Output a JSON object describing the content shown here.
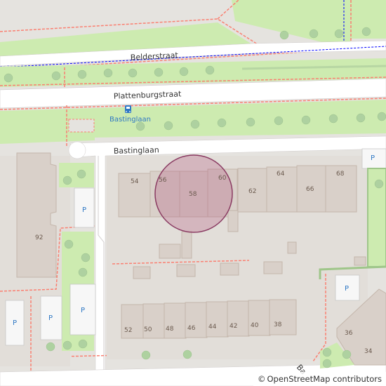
{
  "map": {
    "streets": {
      "belderstraat": "Belderstraat",
      "plattenburgstraat": "Plattenburgstraat",
      "bastinglaan": "Bastinglaan",
      "bottom_partial": "Ba"
    },
    "bus_stop": {
      "label": "Bastinglaan",
      "icon": "bus-stop-icon"
    },
    "parking_label": "P",
    "house_numbers": {
      "n54": "54",
      "n56": "56",
      "n58": "58",
      "n60": "60",
      "n62": "62",
      "n64": "64",
      "n66": "66",
      "n68": "68",
      "n92": "92",
      "n52": "52",
      "n50": "50",
      "n48": "48",
      "n46": "46",
      "n44": "44",
      "n42": "42",
      "n40": "40",
      "n38": "38",
      "n36": "36",
      "n34": "34"
    },
    "highlight": {
      "address_number": "58",
      "color": "#b04f7a"
    },
    "colors": {
      "grass": "#cdebb0",
      "building": "#d9d0c9",
      "building_outline": "#c4b6ab",
      "road": "#ffffff",
      "footway": "#fa8072",
      "cycleway": "#0000ff",
      "tree": "#aed1a0"
    }
  },
  "attribution": {
    "symbol": "©",
    "text": "OpenStreetMap contributors"
  }
}
